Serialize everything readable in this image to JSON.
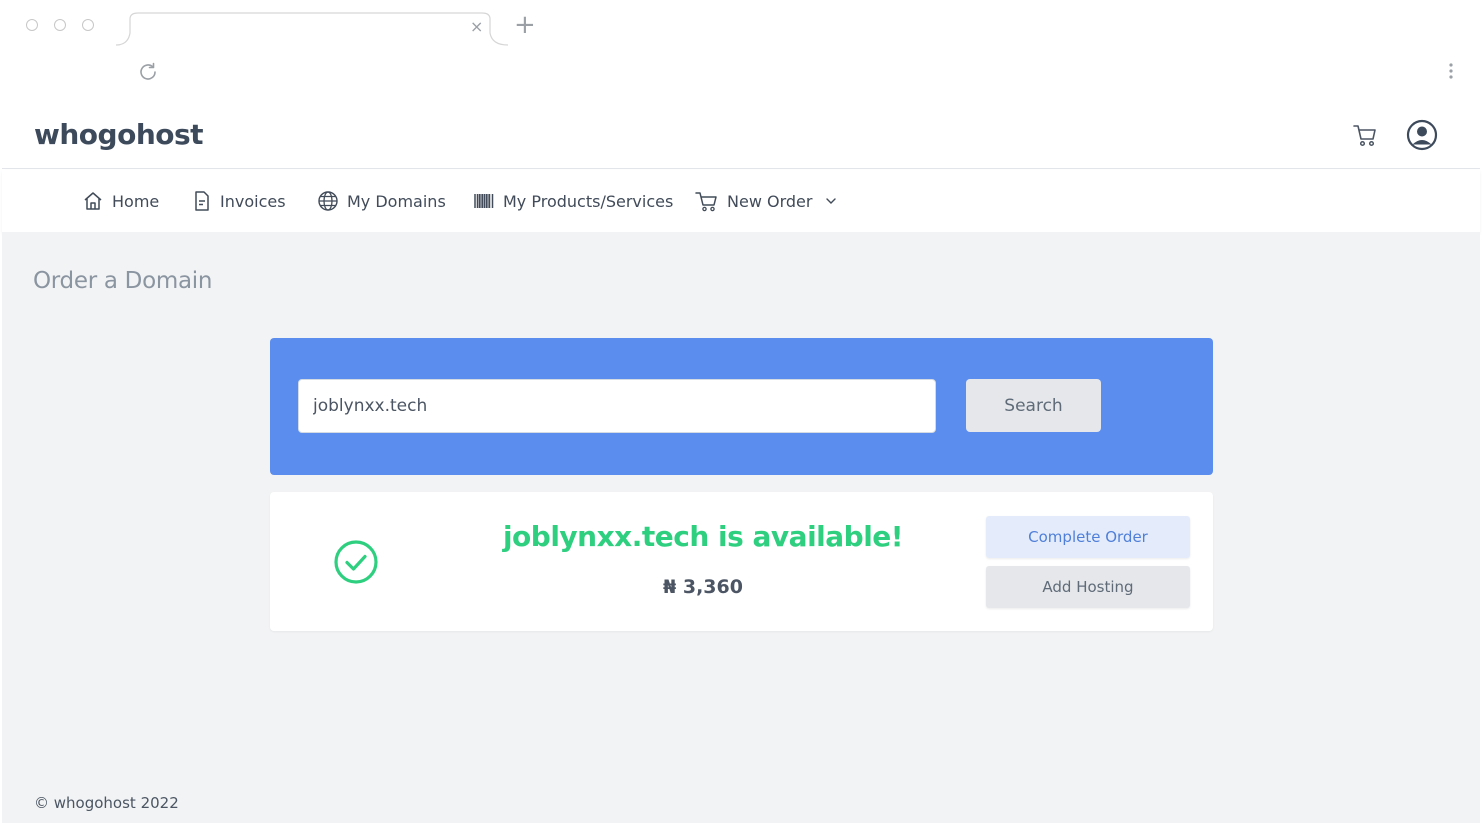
{
  "app": {
    "brand": "whogohost",
    "page_title": "Order a Domain",
    "footer": "© whogohost 2022"
  },
  "nav": {
    "items": [
      {
        "label": "Home",
        "icon": "home-icon"
      },
      {
        "label": "Invoices",
        "icon": "invoice-icon"
      },
      {
        "label": "My Domains",
        "icon": "globe-icon"
      },
      {
        "label": "My Products/Services",
        "icon": "barcode-icon"
      },
      {
        "label": "New Order",
        "icon": "cart-icon"
      }
    ]
  },
  "search": {
    "value": "joblynxx.tech",
    "button_label": "Search"
  },
  "result": {
    "availability_text": "joblynxx.tech is available!",
    "price": "₦ 3,360",
    "complete_label": "Complete Order",
    "hosting_label": "Add Hosting"
  },
  "colors": {
    "accent_blue": "#5b8def",
    "success_green": "#2fcf80",
    "background": "#f2f3f4"
  }
}
